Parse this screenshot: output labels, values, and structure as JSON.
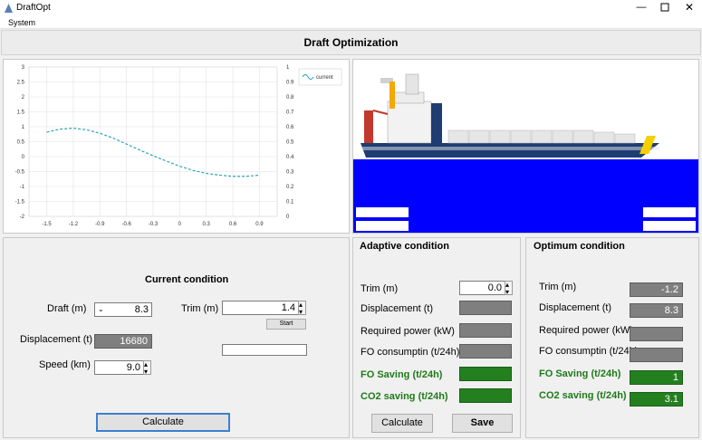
{
  "window": {
    "title": "DraftOpt"
  },
  "menu": {
    "items": [
      "System"
    ]
  },
  "header": {
    "title": "Draft Optimization"
  },
  "chart_data": {
    "type": "line",
    "series": [
      {
        "name": "current",
        "x": [
          -1.5,
          -1.35,
          -1.2,
          -1.05,
          -0.9,
          -0.75,
          -0.6,
          -0.45,
          -0.3,
          -0.15,
          0.0,
          0.15,
          0.3,
          0.45,
          0.6,
          0.75,
          0.9
        ],
        "values": [
          0.82,
          0.92,
          0.95,
          0.9,
          0.78,
          0.62,
          0.42,
          0.22,
          0.03,
          -0.15,
          -0.32,
          -0.46,
          -0.56,
          -0.62,
          -0.66,
          -0.66,
          -0.62
        ]
      }
    ],
    "xlim": [
      -1.7,
      1.1
    ],
    "ylim": [
      -2,
      3
    ],
    "x_ticks": [
      "-1.5",
      "-1.2",
      "-0.9",
      "-0.6",
      "-0.3",
      "0",
      "0.3",
      "0.6",
      "0.9"
    ],
    "y_ticks": [
      "3",
      "2.5",
      "2",
      "1.5",
      "1",
      "0.5",
      "0",
      "-0.5",
      "-1",
      "-1.5",
      "-2"
    ],
    "y2_ticks": [
      "1",
      "0.9",
      "0.8",
      "0.7",
      "0.6",
      "0.5",
      "0.4",
      "0.3",
      "0.2",
      "0.1",
      "0"
    ],
    "grid": true,
    "legend": "top-right",
    "color": "#2aa4b8"
  },
  "current": {
    "title": "Current condition",
    "draft_label": "Draft (m)",
    "draft_value": "8.3",
    "trim_label": "Trim (m)",
    "trim_value": "1.4",
    "start_label": "Start",
    "displacement_label": "Displacement (t)",
    "displacement_value": "16680",
    "speed_label": "Speed (km)",
    "speed_value": "9.0",
    "calculate_label": "Calculate"
  },
  "adaptive": {
    "title": "Adaptive condition",
    "trim_label": "Trim (m)",
    "trim_value": "0.0",
    "displacement_label": "Displacement (t)",
    "power_label": "Required power (kW)",
    "fo_label": "FO consumptin (t/24h)",
    "fo_saving_label": "FO Saving (t/24h)",
    "co2_saving_label": "CO2 saving (t/24h)",
    "calculate_label": "Calculate",
    "save_label": "Save"
  },
  "optimum": {
    "title": "Optimum condition",
    "trim_label": "Trim  (m)",
    "trim_value": "-1.2",
    "displacement_label": "Displacement (t)",
    "displacement_value": "8.3",
    "power_label": "Required power (kW)",
    "fo_label": "FO consumptin (t/24h)",
    "fo_saving_label": "FO Saving (t/24h)",
    "fo_saving_value": "1",
    "co2_saving_label": "CO2 saving (t/24h)",
    "co2_saving_value": "3.1"
  },
  "colors": {
    "water": "#0000ff",
    "hull": "#1e3d73",
    "saving": "#24801f"
  }
}
